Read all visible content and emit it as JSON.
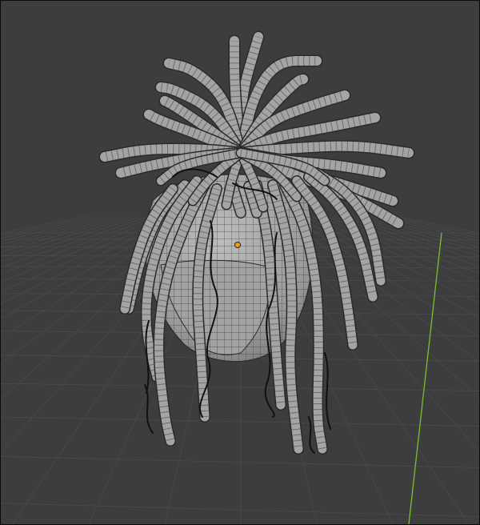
{
  "viewport": {
    "mode": "3d-viewport",
    "background": "#3d3d3d",
    "grid_color": "#4a4a4a",
    "y_axis_color": "#7bbf2a",
    "mesh_fill": "#a9a9a9",
    "mesh_shade": "#6f6f6f",
    "wire_color": "#2a2a2a",
    "origin_color": "#f0a020",
    "object_icon": "hair-mesh-icon",
    "origin_icon": "object-origin-icon"
  }
}
